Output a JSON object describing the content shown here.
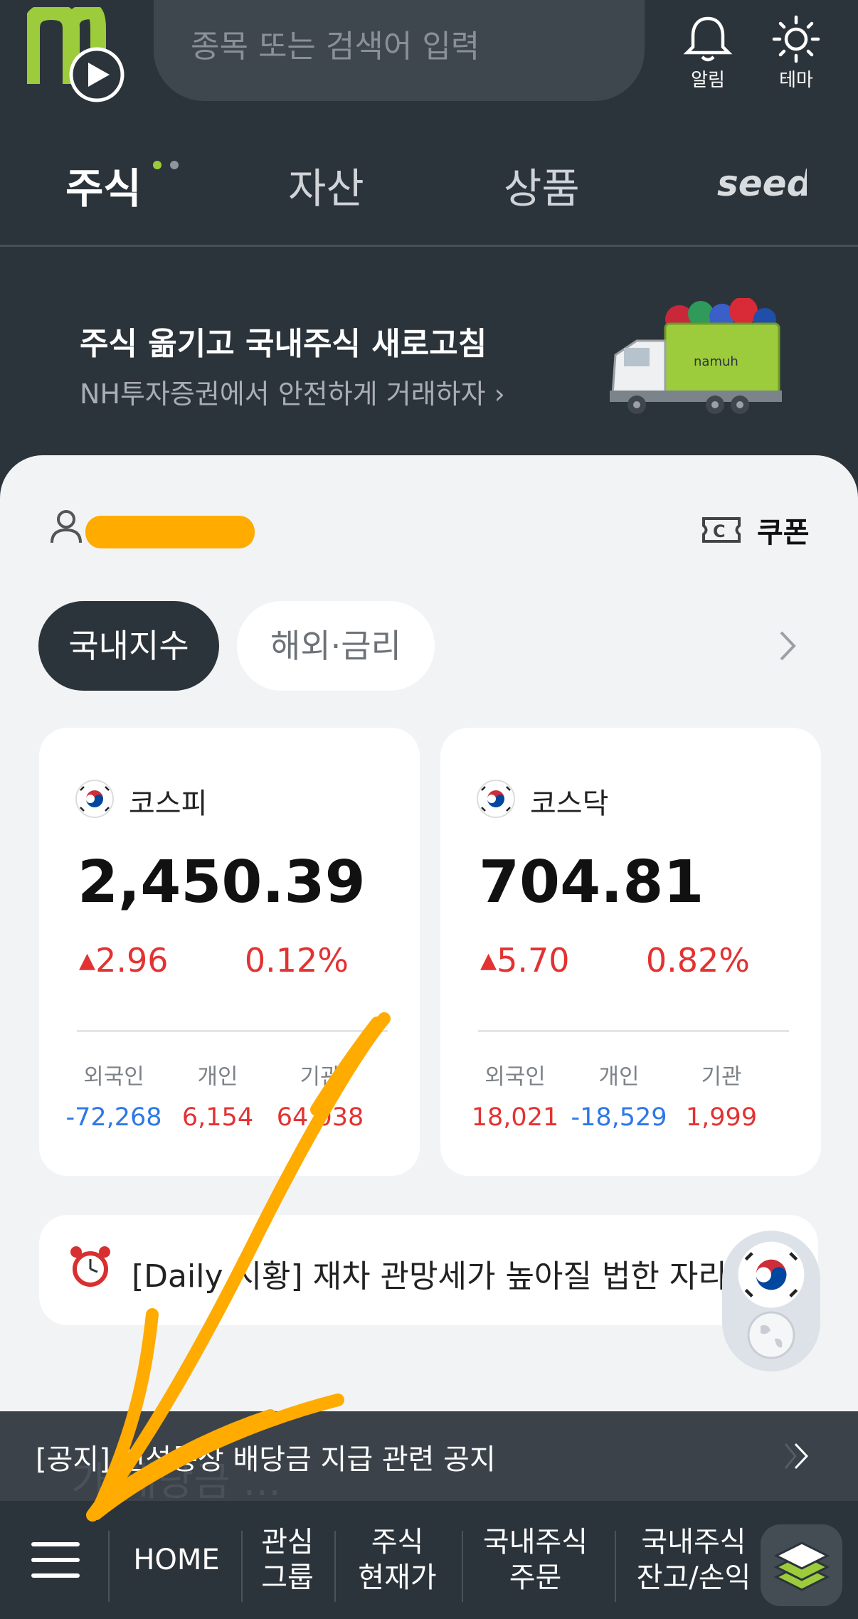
{
  "header": {
    "search_placeholder": "종목 또는 검색어 입력",
    "alarm_label": "알림",
    "theme_label": "테마",
    "tabs": [
      {
        "label": "주식",
        "active": true
      },
      {
        "label": "자산",
        "active": false
      },
      {
        "label": "상품",
        "active": false
      }
    ],
    "seed_logo": "seed"
  },
  "banner": {
    "title": "주식 옮기고 국내주식 새로고침",
    "subtitle": "NH투자증권에서 안전하게 거래하자 ›",
    "truck_text": "namuh"
  },
  "account": {
    "user_name": "",
    "coupon_label": "쿠폰"
  },
  "index_tabs": [
    "국내지수",
    "해외·금리"
  ],
  "indices": [
    {
      "name": "코스피",
      "value": "2,450.39",
      "change": "2.96",
      "rate": "0.12%",
      "investors": [
        {
          "label": "외국인",
          "value": "-72,268",
          "trend": "down"
        },
        {
          "label": "개인",
          "value": "6,154",
          "trend": "up"
        },
        {
          "label": "기관",
          "value": "64,038",
          "trend": "up"
        }
      ]
    },
    {
      "name": "코스닥",
      "value": "704.81",
      "change": "5.70",
      "rate": "0.82%",
      "investors": [
        {
          "label": "외국인",
          "value": "18,021",
          "trend": "up"
        },
        {
          "label": "개인",
          "value": "-18,529",
          "trend": "down"
        },
        {
          "label": "기관",
          "value": "1,999",
          "trend": "up"
        }
      ]
    }
  ],
  "daily_news": "[Daily 시황] 재차 관망세가 높아질 법한 자리",
  "notice": "[공지] 신성통상 배당금 지급 관련 공지",
  "notice_ghost": "가 배당금 ...",
  "bottom_nav": [
    {
      "label": "HOME"
    },
    {
      "label": "관심\n그룹"
    },
    {
      "label": "주식\n현재가"
    },
    {
      "label": "국내주식\n주문"
    },
    {
      "label": "국내주식\n잔고/손익"
    }
  ],
  "colors": {
    "header_bg": "#2c343b",
    "body_bg": "#f2f3f5",
    "up_red": "#e33232",
    "down_blue": "#2d78e8",
    "brand_green": "#9ccc3c",
    "annotation_orange": "#ffab00"
  },
  "icons": {
    "logo": "nh-logo-icon",
    "alarm": "bell-icon",
    "theme": "sun-icon",
    "user": "user-icon",
    "coupon": "coupon-icon",
    "menu": "hamburger-icon",
    "layers": "layers-icon"
  }
}
